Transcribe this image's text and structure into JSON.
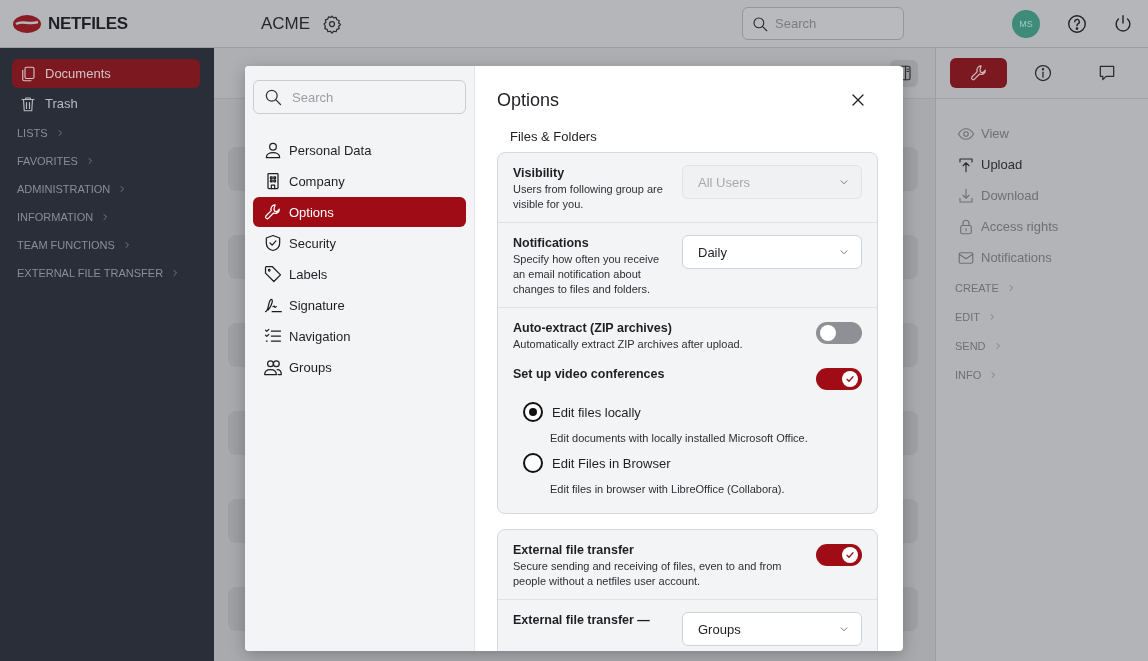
{
  "topbar": {
    "brand": "NETFILES",
    "workspace": "ACME",
    "search": {
      "placeholder": "Search"
    },
    "avatar": "MS"
  },
  "sidebar": {
    "items": [
      {
        "label": "Documents",
        "selected": true
      },
      {
        "label": "Trash",
        "selected": false
      }
    ],
    "sections": [
      "LISTS",
      "FAVORITES",
      "ADMINISTRATION",
      "INFORMATION",
      "TEAM FUNCTIONS",
      "EXTERNAL FILE TRANSFER"
    ]
  },
  "right_panel": {
    "tabs": [
      {
        "selected": true
      },
      {
        "selected": false
      },
      {
        "selected": false
      }
    ],
    "actions": [
      {
        "label": "View",
        "disabled": true
      },
      {
        "label": "Upload",
        "disabled": false
      },
      {
        "label": "Download",
        "disabled": true
      },
      {
        "label": "Access rights",
        "disabled": true
      },
      {
        "label": "Notifications",
        "disabled": true
      }
    ],
    "sections": [
      "CREATE",
      "EDIT",
      "SEND",
      "INFO"
    ]
  },
  "dialog": {
    "search": {
      "placeholder": "Search"
    },
    "nav": [
      {
        "label": "Personal Data",
        "selected": false
      },
      {
        "label": "Company",
        "selected": false
      },
      {
        "label": "Options",
        "selected": true
      },
      {
        "label": "Security",
        "selected": false
      },
      {
        "label": "Labels",
        "selected": false
      },
      {
        "label": "Signature",
        "selected": false
      },
      {
        "label": "Navigation",
        "selected": false
      },
      {
        "label": "Groups",
        "selected": false
      }
    ],
    "title": "Options",
    "heading": "Files & Folders",
    "groups": [
      {
        "sections": [
          {
            "settings": [
              {
                "kind": "select",
                "title": "Visibility",
                "description": "Users from following group are visible for you.",
                "value": "All Users",
                "disabled": true
              }
            ]
          },
          {
            "settings": [
              {
                "kind": "select",
                "title": "Notifications",
                "description": "Specify how often you receive an email notification about changes to files and folders.",
                "value": "Daily",
                "disabled": false
              }
            ]
          },
          {
            "settings": [
              {
                "kind": "toggle",
                "title": "Auto-extract (ZIP archives)",
                "description": "Automatically extract ZIP archives after upload.",
                "on": false
              },
              {
                "kind": "toggle",
                "title": "Set up video conferences",
                "on": true,
                "options": [
                  {
                    "label": "Edit files locally",
                    "description": "Edit documents with locally installed Microsoft Office.",
                    "selected": true
                  },
                  {
                    "label": "Edit Files in Browser",
                    "description": "Edit files in browser with LibreOffice (Collabora).",
                    "selected": false
                  }
                ]
              }
            ]
          }
        ]
      },
      {
        "sections": [
          {
            "settings": [
              {
                "kind": "toggle",
                "title": "External file transfer",
                "description": "Secure sending and receiving of files, even to and from people without a netfiles user account.",
                "on": true
              }
            ]
          },
          {
            "settings": [
              {
                "kind": "select",
                "title": "External file transfer —",
                "value": "Groups",
                "disabled": false
              }
            ]
          }
        ]
      }
    ]
  }
}
